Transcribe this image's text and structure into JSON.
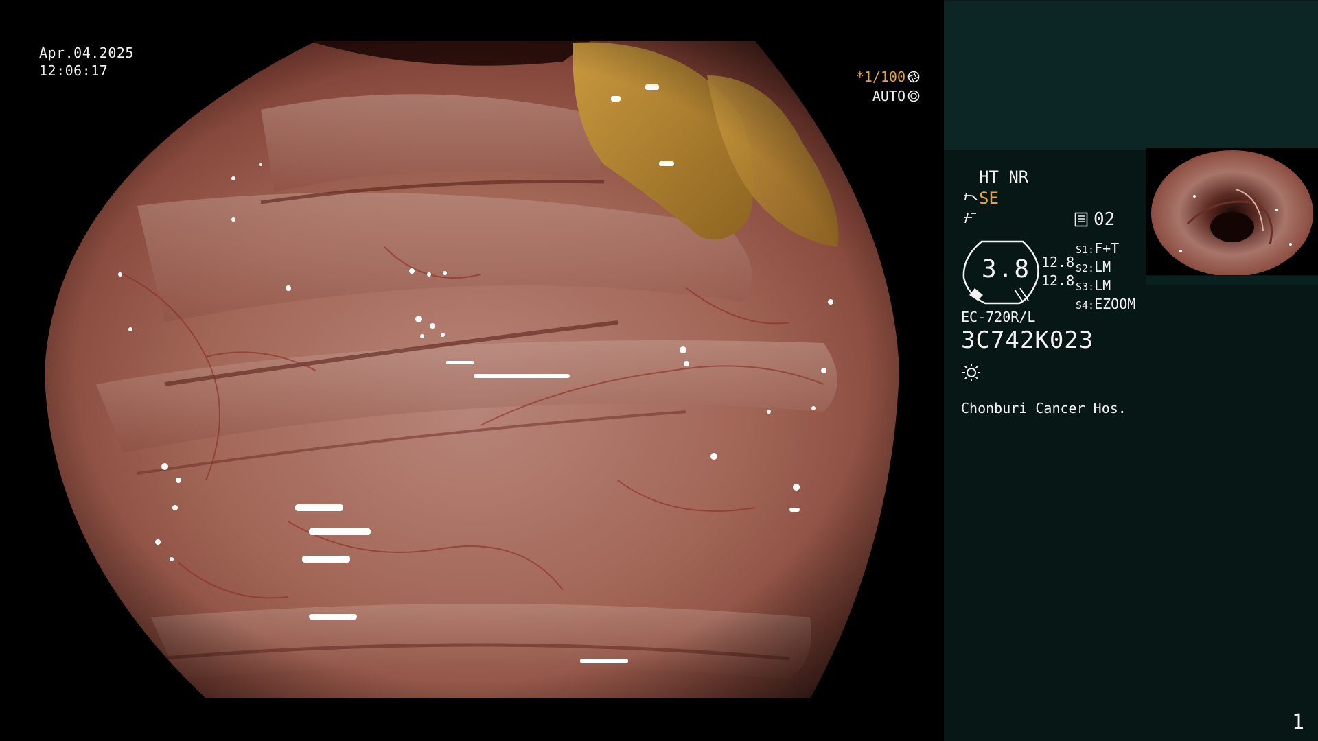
{
  "screen": {
    "date": "Apr.04.2025",
    "time": "12:06:17",
    "shutter_speed": "*1/100",
    "iris_mode": "AUTO"
  },
  "panel": {
    "enhancement": "HT NR",
    "structure_mode": "SE",
    "memory_number": "02",
    "gauge_value": "3.8",
    "gain_top": "12.8",
    "gain_bottom": "12.8",
    "slots": [
      {
        "key": "S1:",
        "value": "F+T"
      },
      {
        "key": "S2:",
        "value": "LM"
      },
      {
        "key": "S3:",
        "value": "LM"
      },
      {
        "key": "S4:",
        "value": "EZOOM"
      }
    ],
    "scope_model": "EC-720R/L",
    "scope_serial": "3C742K023",
    "hospital": "Chonburi Cancer Hos.",
    "page_number": "1"
  },
  "colors": {
    "osd_text": "#f2f2f2",
    "accent_amber": "#e6a53c",
    "side_panel_bg": "#061716",
    "side_panel_top_bg": "#0b2624",
    "mucosa_base": "#9a5a4a",
    "stool_fragment": "#b0822f"
  },
  "icons": {
    "shutter": "aperture-icon",
    "iris": "iris-icon",
    "structure": "scope-icon",
    "color": "color-enhance-icon",
    "memory": "memory-card-icon",
    "light": "light-source-icon"
  }
}
